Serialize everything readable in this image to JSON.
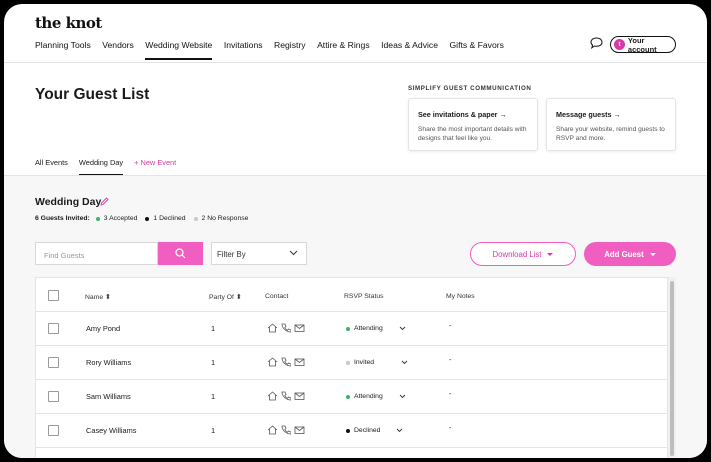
{
  "brand": {
    "logo": "the knot",
    "accent": "#ef5ec0"
  },
  "nav": [
    "Planning Tools",
    "Vendors",
    "Wedding Website",
    "Invitations",
    "Registry",
    "Attire & Rings",
    "Ideas & Advice",
    "Gifts & Favors"
  ],
  "account": {
    "avatar": "t",
    "label": "Your account"
  },
  "page": {
    "title": "Your Guest List"
  },
  "simplify": {
    "heading": "SIMPLIFY GUEST COMMUNICATION",
    "cards": [
      {
        "title": "See invitations & paper",
        "desc": "Share the most important details with designs that feel like you."
      },
      {
        "title": "Message guests",
        "desc": "Share your website, remind guests to RSVP and more."
      }
    ]
  },
  "tabs": {
    "all": "All Events",
    "wedding": "Wedding Day",
    "new": "+ New Event"
  },
  "event": {
    "title": "Wedding Day",
    "invited_label": "6 Guests Invited:",
    "accepted": "3 Accepted",
    "declined": "1 Declined",
    "no_response": "2 No Response"
  },
  "toolbar": {
    "search_placeholder": "Find Guests",
    "filter": "Filter By",
    "download": "Download List",
    "add": "Add Guest"
  },
  "table": {
    "headers": {
      "name": "Name",
      "party": "Party Of",
      "contact": "Contact",
      "rsvp": "RSVP Status",
      "notes": "My Notes"
    },
    "rows": [
      {
        "name": "Amy Pond",
        "party": "1",
        "status": "Attending",
        "status_color": "#3bb36a",
        "notes": "-"
      },
      {
        "name": "Rory Williams",
        "party": "1",
        "status": "Invited",
        "status_color": "#c8c8c8",
        "notes": "-"
      },
      {
        "name": "Sam Williams",
        "party": "1",
        "status": "Attending",
        "status_color": "#3bb36a",
        "notes": "-"
      },
      {
        "name": "Casey Williams",
        "party": "1",
        "status": "Declined",
        "status_color": "#111111",
        "notes": "-"
      }
    ]
  }
}
